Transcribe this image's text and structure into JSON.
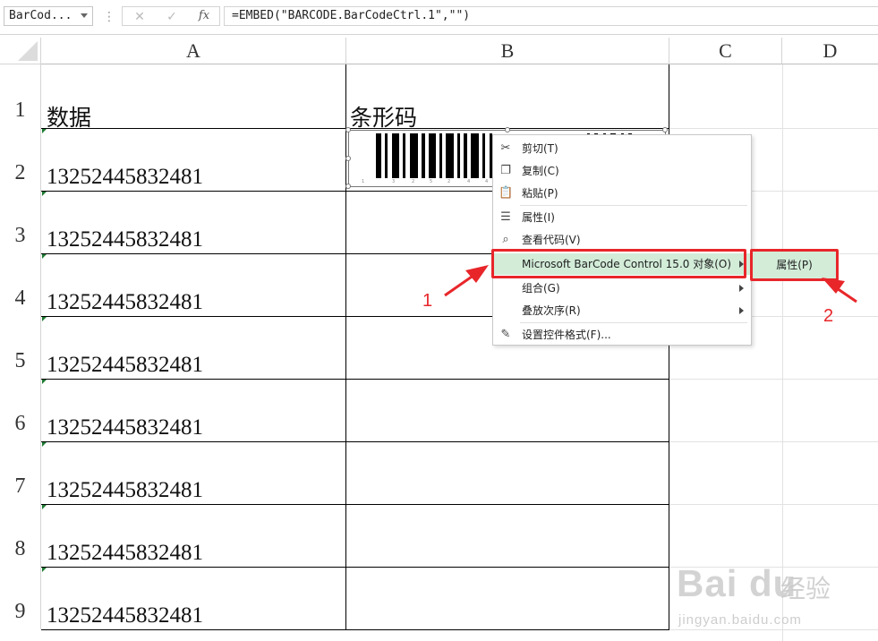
{
  "formula_bar": {
    "name_box": "BarCod...",
    "separator": "⋮",
    "cancel_glyph": "✕",
    "enter_glyph": "✓",
    "fx_label": "fx",
    "formula": "=EMBED(\"BARCODE.BarCodeCtrl.1\",\"\")"
  },
  "columns": [
    "A",
    "B",
    "C",
    "D"
  ],
  "rows": [
    "1",
    "2",
    "3",
    "4",
    "5",
    "6",
    "7",
    "8",
    "9"
  ],
  "cells": {
    "header_a": "数据",
    "header_b": "条形码",
    "values": [
      "13252445832481",
      "13252445832481",
      "13252445832481",
      "13252445832481",
      "13252445832481",
      "13252445832481",
      "13252445832481",
      "13252445832481"
    ]
  },
  "barcode_object": {
    "type": "BarCode control"
  },
  "context_menu": {
    "items": [
      {
        "label": "剪切(T)",
        "icon": "scissors-icon"
      },
      {
        "label": "复制(C)",
        "icon": "copy-icon"
      },
      {
        "label": "粘贴(P)",
        "icon": "paste-icon"
      },
      {
        "label": "属性(I)",
        "icon": "properties-icon"
      },
      {
        "label": "查看代码(V)",
        "icon": "view-code-icon"
      },
      {
        "label": "Microsoft BarCode Control 15.0 对象(O)",
        "icon": ""
      },
      {
        "label": "组合(G)",
        "icon": ""
      },
      {
        "label": "叠放次序(R)",
        "icon": ""
      },
      {
        "label": "设置控件格式(F)...",
        "icon": "format-control-icon"
      }
    ]
  },
  "submenu": {
    "label": "属性(P)"
  },
  "annotations": {
    "step1": "1",
    "step2": "2",
    "color": "#e8262a"
  },
  "watermark": {
    "logo": "Bai du",
    "text": "经验",
    "url": "jingyan.baidu.com"
  }
}
